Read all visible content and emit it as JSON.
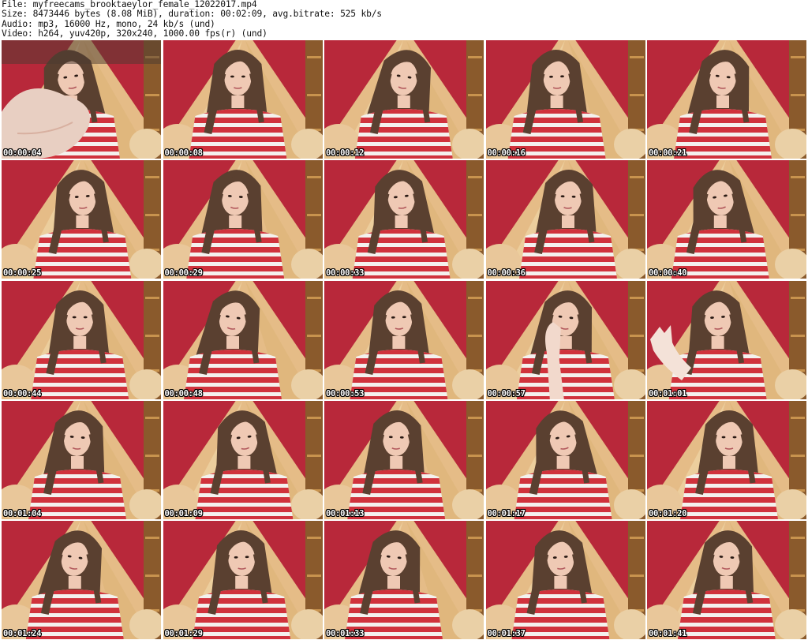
{
  "header": {
    "file_line": "File: myfreecams_brooktaeylor_female_12022017.mp4",
    "size_line": "Size: 8473446 bytes (8.08 MiB), duration: 00:02:09, avg.bitrate: 525 kb/s",
    "audio_line": "Audio: mp3, 16000 Hz, mono, 24 kb/s (und)",
    "video_line": "Video: h264, yuv420p, 320x240, 1000.00 fps(r) (und)"
  },
  "thumbnails": [
    {
      "timestamp": "00:00:04",
      "gesture": "hand"
    },
    {
      "timestamp": "00:00:08",
      "gesture": "none"
    },
    {
      "timestamp": "00:00:12",
      "gesture": "none"
    },
    {
      "timestamp": "00:00:16",
      "gesture": "none"
    },
    {
      "timestamp": "00:00:21",
      "gesture": "none"
    },
    {
      "timestamp": "00:00:25",
      "gesture": "none"
    },
    {
      "timestamp": "00:00:29",
      "gesture": "none"
    },
    {
      "timestamp": "00:00:33",
      "gesture": "none"
    },
    {
      "timestamp": "00:00:36",
      "gesture": "none"
    },
    {
      "timestamp": "00:00:40",
      "gesture": "none"
    },
    {
      "timestamp": "00:00:44",
      "gesture": "none"
    },
    {
      "timestamp": "00:00:48",
      "gesture": "none"
    },
    {
      "timestamp": "00:00:53",
      "gesture": "none"
    },
    {
      "timestamp": "00:00:57",
      "gesture": "hand-face"
    },
    {
      "timestamp": "00:01:01",
      "gesture": "hand-wave"
    },
    {
      "timestamp": "00:01:04",
      "gesture": "none"
    },
    {
      "timestamp": "00:01:09",
      "gesture": "none"
    },
    {
      "timestamp": "00:01:13",
      "gesture": "none"
    },
    {
      "timestamp": "00:01:17",
      "gesture": "none"
    },
    {
      "timestamp": "00:01:20",
      "gesture": "none"
    },
    {
      "timestamp": "00:01:24",
      "gesture": "none"
    },
    {
      "timestamp": "00:01:29",
      "gesture": "none"
    },
    {
      "timestamp": "00:01:33",
      "gesture": "none"
    },
    {
      "timestamp": "00:01:37",
      "gesture": "none"
    },
    {
      "timestamp": "00:01:41",
      "gesture": "none"
    }
  ],
  "colors": {
    "wall": "#b8283a",
    "curtain": "#e8c98e",
    "shirt_red": "#d0323c",
    "shirt_white": "#f4f1ee",
    "hair": "#5a4030",
    "skin": "#efc9b4"
  }
}
